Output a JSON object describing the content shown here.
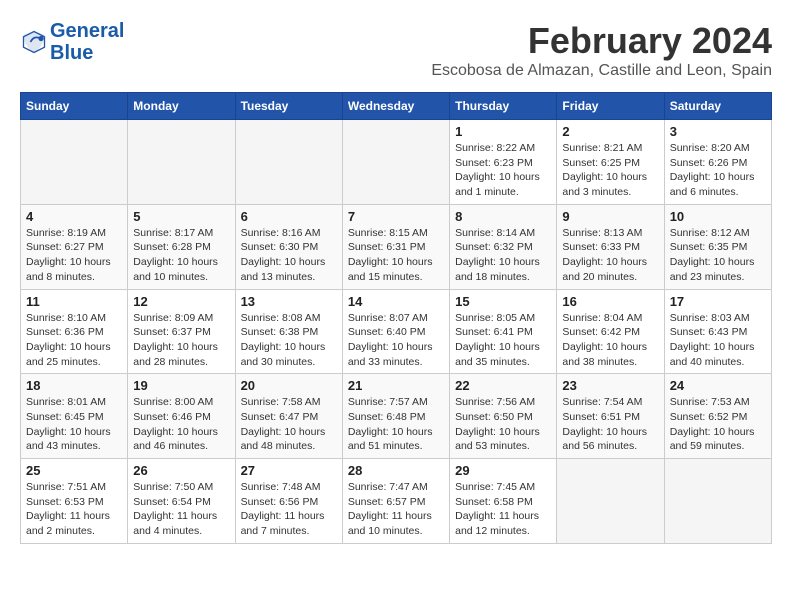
{
  "app": {
    "name": "GeneralBlue",
    "title": "February 2024",
    "location": "Escobosa de Almazan, Castille and Leon, Spain"
  },
  "calendar": {
    "headers": [
      "Sunday",
      "Monday",
      "Tuesday",
      "Wednesday",
      "Thursday",
      "Friday",
      "Saturday"
    ],
    "weeks": [
      [
        {
          "day": "",
          "info": ""
        },
        {
          "day": "",
          "info": ""
        },
        {
          "day": "",
          "info": ""
        },
        {
          "day": "",
          "info": ""
        },
        {
          "day": "1",
          "info": "Sunrise: 8:22 AM\nSunset: 6:23 PM\nDaylight: 10 hours and 1 minute."
        },
        {
          "day": "2",
          "info": "Sunrise: 8:21 AM\nSunset: 6:25 PM\nDaylight: 10 hours and 3 minutes."
        },
        {
          "day": "3",
          "info": "Sunrise: 8:20 AM\nSunset: 6:26 PM\nDaylight: 10 hours and 6 minutes."
        }
      ],
      [
        {
          "day": "4",
          "info": "Sunrise: 8:19 AM\nSunset: 6:27 PM\nDaylight: 10 hours and 8 minutes."
        },
        {
          "day": "5",
          "info": "Sunrise: 8:17 AM\nSunset: 6:28 PM\nDaylight: 10 hours and 10 minutes."
        },
        {
          "day": "6",
          "info": "Sunrise: 8:16 AM\nSunset: 6:30 PM\nDaylight: 10 hours and 13 minutes."
        },
        {
          "day": "7",
          "info": "Sunrise: 8:15 AM\nSunset: 6:31 PM\nDaylight: 10 hours and 15 minutes."
        },
        {
          "day": "8",
          "info": "Sunrise: 8:14 AM\nSunset: 6:32 PM\nDaylight: 10 hours and 18 minutes."
        },
        {
          "day": "9",
          "info": "Sunrise: 8:13 AM\nSunset: 6:33 PM\nDaylight: 10 hours and 20 minutes."
        },
        {
          "day": "10",
          "info": "Sunrise: 8:12 AM\nSunset: 6:35 PM\nDaylight: 10 hours and 23 minutes."
        }
      ],
      [
        {
          "day": "11",
          "info": "Sunrise: 8:10 AM\nSunset: 6:36 PM\nDaylight: 10 hours and 25 minutes."
        },
        {
          "day": "12",
          "info": "Sunrise: 8:09 AM\nSunset: 6:37 PM\nDaylight: 10 hours and 28 minutes."
        },
        {
          "day": "13",
          "info": "Sunrise: 8:08 AM\nSunset: 6:38 PM\nDaylight: 10 hours and 30 minutes."
        },
        {
          "day": "14",
          "info": "Sunrise: 8:07 AM\nSunset: 6:40 PM\nDaylight: 10 hours and 33 minutes."
        },
        {
          "day": "15",
          "info": "Sunrise: 8:05 AM\nSunset: 6:41 PM\nDaylight: 10 hours and 35 minutes."
        },
        {
          "day": "16",
          "info": "Sunrise: 8:04 AM\nSunset: 6:42 PM\nDaylight: 10 hours and 38 minutes."
        },
        {
          "day": "17",
          "info": "Sunrise: 8:03 AM\nSunset: 6:43 PM\nDaylight: 10 hours and 40 minutes."
        }
      ],
      [
        {
          "day": "18",
          "info": "Sunrise: 8:01 AM\nSunset: 6:45 PM\nDaylight: 10 hours and 43 minutes."
        },
        {
          "day": "19",
          "info": "Sunrise: 8:00 AM\nSunset: 6:46 PM\nDaylight: 10 hours and 46 minutes."
        },
        {
          "day": "20",
          "info": "Sunrise: 7:58 AM\nSunset: 6:47 PM\nDaylight: 10 hours and 48 minutes."
        },
        {
          "day": "21",
          "info": "Sunrise: 7:57 AM\nSunset: 6:48 PM\nDaylight: 10 hours and 51 minutes."
        },
        {
          "day": "22",
          "info": "Sunrise: 7:56 AM\nSunset: 6:50 PM\nDaylight: 10 hours and 53 minutes."
        },
        {
          "day": "23",
          "info": "Sunrise: 7:54 AM\nSunset: 6:51 PM\nDaylight: 10 hours and 56 minutes."
        },
        {
          "day": "24",
          "info": "Sunrise: 7:53 AM\nSunset: 6:52 PM\nDaylight: 10 hours and 59 minutes."
        }
      ],
      [
        {
          "day": "25",
          "info": "Sunrise: 7:51 AM\nSunset: 6:53 PM\nDaylight: 11 hours and 2 minutes."
        },
        {
          "day": "26",
          "info": "Sunrise: 7:50 AM\nSunset: 6:54 PM\nDaylight: 11 hours and 4 minutes."
        },
        {
          "day": "27",
          "info": "Sunrise: 7:48 AM\nSunset: 6:56 PM\nDaylight: 11 hours and 7 minutes."
        },
        {
          "day": "28",
          "info": "Sunrise: 7:47 AM\nSunset: 6:57 PM\nDaylight: 11 hours and 10 minutes."
        },
        {
          "day": "29",
          "info": "Sunrise: 7:45 AM\nSunset: 6:58 PM\nDaylight: 11 hours and 12 minutes."
        },
        {
          "day": "",
          "info": ""
        },
        {
          "day": "",
          "info": ""
        }
      ]
    ]
  }
}
